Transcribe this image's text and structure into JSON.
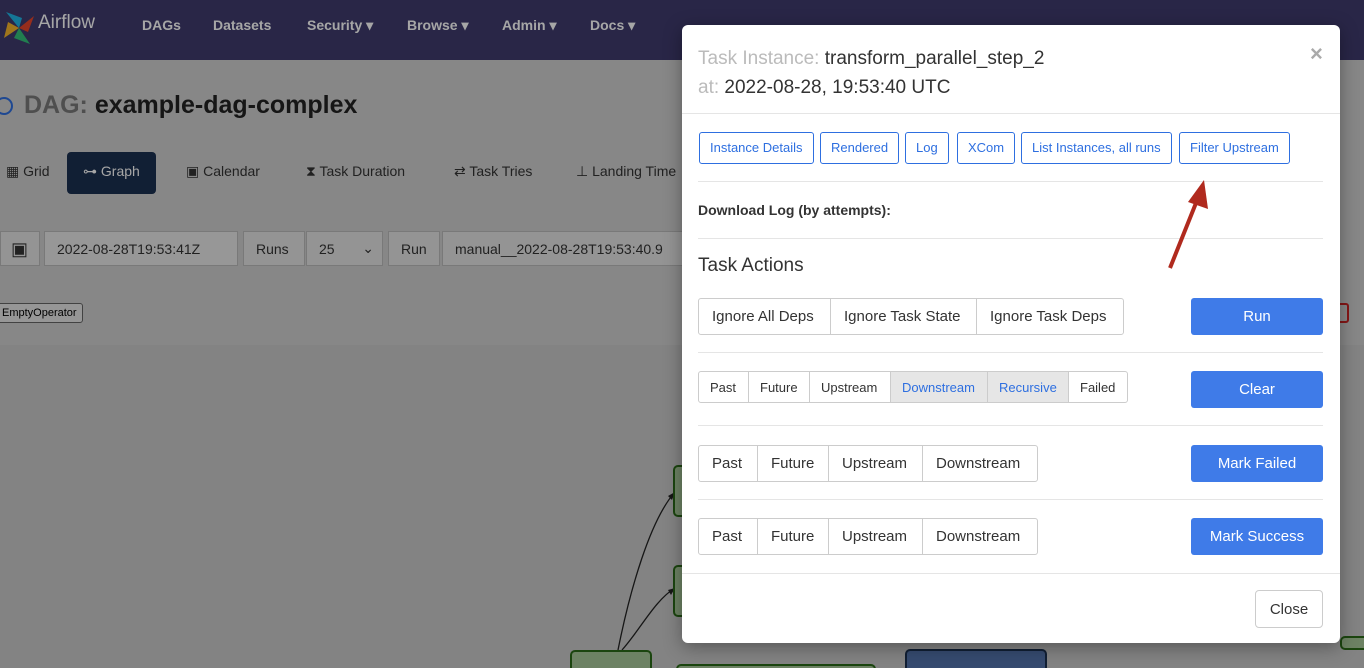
{
  "navbar": {
    "brand": "Airflow",
    "items": [
      "DAGs",
      "Datasets",
      "Security ▾",
      "Browse ▾",
      "Admin ▾",
      "Docs ▾"
    ]
  },
  "dag": {
    "label": "DAG:",
    "name": "example-dag-complex"
  },
  "views": [
    "Grid",
    "Graph",
    "Calendar",
    "Task Duration",
    "Task Tries",
    "Landing Time"
  ],
  "controls": {
    "date": "2022-08-28T19:53:41Z",
    "runs_label": "Runs",
    "runs_value": "25",
    "run_label": "Run",
    "run_value": "manual__2022-08-28T19:53:40.9"
  },
  "operator_tag": "EmptyOperator",
  "modal": {
    "title_label": "Task Instance:",
    "task_id": "transform_parallel_step_2",
    "at_label": "at:",
    "timestamp": "2022-08-28, 19:53:40 UTC",
    "link_buttons": [
      "Instance Details",
      "Rendered",
      "Log",
      "XCom",
      "List Instances, all runs",
      "Filter Upstream"
    ],
    "download_log": "Download Log (by attempts):",
    "task_actions": "Task Actions",
    "run_options": [
      "Ignore All Deps",
      "Ignore Task State",
      "Ignore Task Deps"
    ],
    "run_button": "Run",
    "clear_options": [
      "Past",
      "Future",
      "Upstream",
      "Downstream",
      "Recursive",
      "Failed"
    ],
    "clear_button": "Clear",
    "failed_options": [
      "Past",
      "Future",
      "Upstream",
      "Downstream"
    ],
    "failed_button": "Mark Failed",
    "success_options": [
      "Past",
      "Future",
      "Upstream",
      "Downstream"
    ],
    "success_button": "Mark Success",
    "close_button": "Close",
    "close_x": "×"
  },
  "colors": {
    "navbar": "#3f3b6e",
    "primary": "#3f7be8",
    "annotation_arrow": "#b02a1e"
  }
}
